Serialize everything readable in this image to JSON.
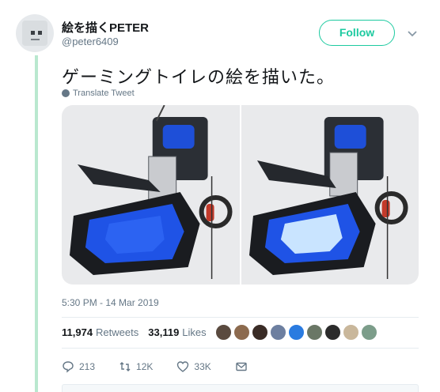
{
  "user": {
    "display_name": "絵を描くPETER",
    "handle": "@peter6409"
  },
  "follow_label": "Follow",
  "tweet": {
    "text": "ゲーミングトイレの絵を描いた。",
    "translate_label": "Translate Tweet",
    "timestamp": "5:30 PM - 14 Mar 2019"
  },
  "stats": {
    "retweets_count": "11,974",
    "retweets_label": "Retweets",
    "likes_count": "33,119",
    "likes_label": "Likes"
  },
  "likers": [
    "#5a4a3f",
    "#8c6a4e",
    "#3a2c26",
    "#6d7fa0",
    "#2a7be0",
    "#6a7766",
    "#2b2b2b",
    "#c9b79b",
    "#7c9d8a"
  ],
  "actions": {
    "reply_count": "213",
    "retweet_count": "12K",
    "like_count": "33K"
  },
  "colors": {
    "accent": "#1dcaa0",
    "thread_line": "#b9e8cf",
    "secondary_text": "#657786"
  },
  "icons": [
    "chevron-down-icon",
    "globe-icon",
    "reply-icon",
    "retweet-icon",
    "heart-icon",
    "message-icon"
  ]
}
